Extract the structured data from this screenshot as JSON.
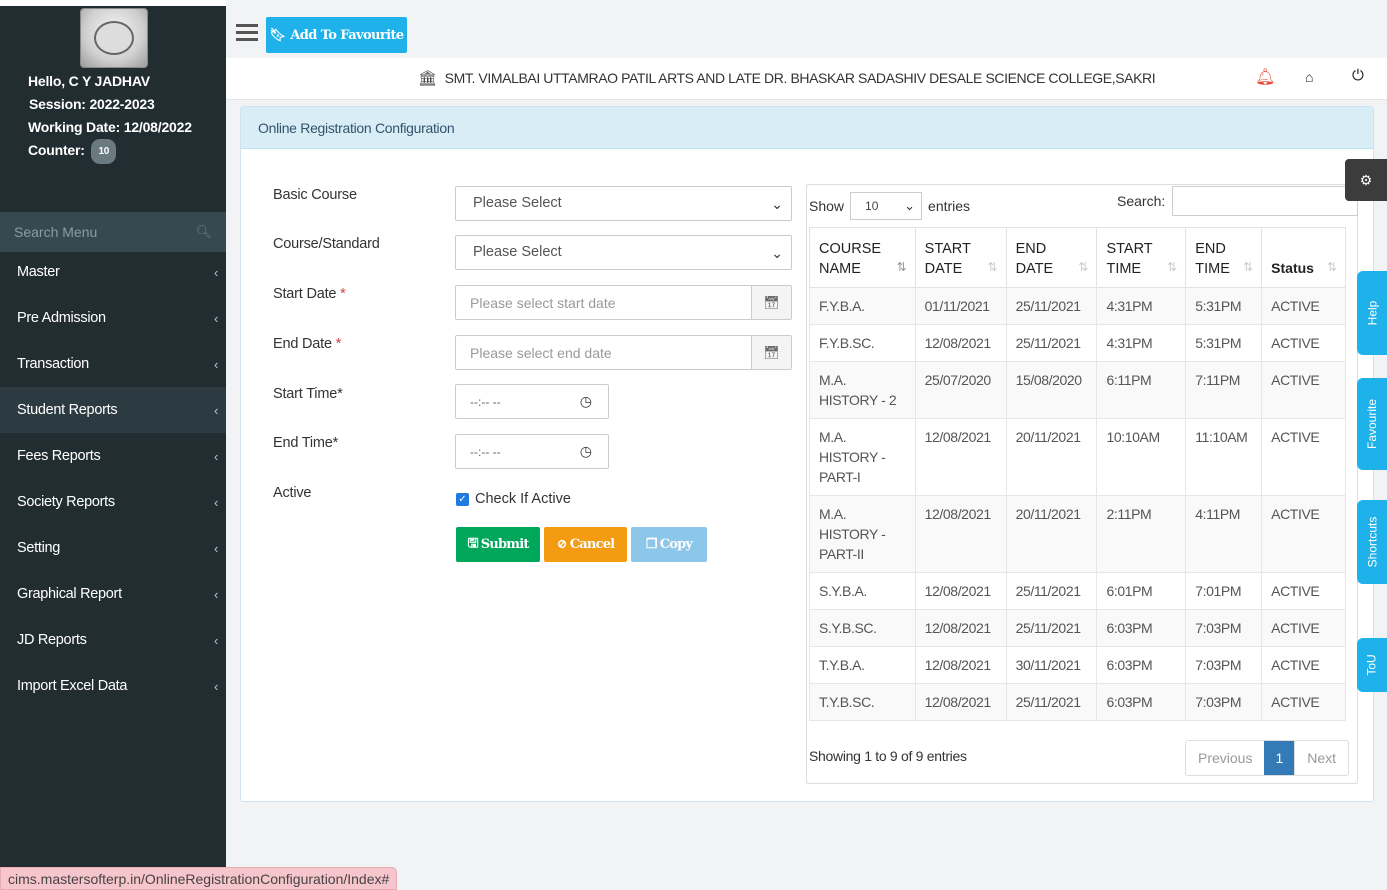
{
  "sidebar": {
    "user": {
      "greeting": "Hello, C Y JADHAV",
      "session": "Session: 2022-2023",
      "working_date": "Working Date: 12/08/2022",
      "counter_label": "Counter:",
      "counter_value": "10"
    },
    "search_placeholder": "Search Menu",
    "items": [
      {
        "label": "Master"
      },
      {
        "label": "Pre Admission"
      },
      {
        "label": "Transaction"
      },
      {
        "label": "Student Reports"
      },
      {
        "label": "Fees Reports"
      },
      {
        "label": "Society Reports"
      },
      {
        "label": "Setting"
      },
      {
        "label": "Graphical Report"
      },
      {
        "label": "JD Reports"
      },
      {
        "label": "Import Excel Data"
      }
    ],
    "active_item": "Student Reports"
  },
  "topbar": {
    "favourite_label": "Add To Favourite",
    "college_name": "SMT. VIMALBAI UTTAMRAO PATIL ARTS AND LATE DR. BHASKAR SADASHIV DESALE SCIENCE COLLEGE,SAKRI"
  },
  "panel": {
    "title": "Online Registration Configuration"
  },
  "form": {
    "basic_course_label": "Basic Course",
    "basic_course_value": "Please Select",
    "course_standard_label": "Course/Standard",
    "course_standard_value": "Please Select",
    "start_date_label": "Start Date",
    "start_date_placeholder": "Please select start date",
    "end_date_label": "End Date",
    "end_date_placeholder": "Please select end date",
    "start_time_label": "Start Time*",
    "start_time_value": "--:-- --",
    "end_time_label": "End Time*",
    "end_time_value": "--:-- --",
    "active_label": "Active",
    "active_checkbox_label": "Check If Active",
    "active_checked": true,
    "submit_label": "Submit",
    "cancel_label": "Cancel",
    "copy_label": "Copy"
  },
  "table": {
    "show_label": "Show",
    "length_value": "10",
    "entries_label": "entries",
    "search_label": "Search:",
    "headers": [
      {
        "line1": "COURSE",
        "line2": "NAME"
      },
      {
        "line1": "START",
        "line2": "DATE"
      },
      {
        "line1": "END",
        "line2": "DATE"
      },
      {
        "line1": "START",
        "line2": "TIME"
      },
      {
        "line1": "END",
        "line2": "TIME"
      },
      {
        "line1": "",
        "line2": "Status"
      }
    ],
    "rows": [
      {
        "course": "F.Y.B.A.",
        "start_date": "01/11/2021",
        "end_date": "25/11/2021",
        "start_time": "4:31PM",
        "end_time": "5:31PM",
        "status": "ACTIVE"
      },
      {
        "course": "F.Y.B.SC.",
        "start_date": "12/08/2021",
        "end_date": "25/11/2021",
        "start_time": "4:31PM",
        "end_time": "5:31PM",
        "status": "ACTIVE"
      },
      {
        "course": "M.A. HISTORY - 2",
        "start_date": "25/07/2020",
        "end_date": "15/08/2020",
        "start_time": "6:11PM",
        "end_time": "7:11PM",
        "status": "ACTIVE"
      },
      {
        "course": "M.A. HISTORY - PART-I",
        "start_date": "12/08/2021",
        "end_date": "20/11/2021",
        "start_time": "10:10AM",
        "end_time": "11:10AM",
        "status": "ACTIVE"
      },
      {
        "course": "M.A. HISTORY - PART-II",
        "start_date": "12/08/2021",
        "end_date": "20/11/2021",
        "start_time": "2:11PM",
        "end_time": "4:11PM",
        "status": "ACTIVE"
      },
      {
        "course": "S.Y.B.A.",
        "start_date": "12/08/2021",
        "end_date": "25/11/2021",
        "start_time": "6:01PM",
        "end_time": "7:01PM",
        "status": "ACTIVE"
      },
      {
        "course": "S.Y.B.SC.",
        "start_date": "12/08/2021",
        "end_date": "25/11/2021",
        "start_time": "6:03PM",
        "end_time": "7:03PM",
        "status": "ACTIVE"
      },
      {
        "course": "T.Y.B.A.",
        "start_date": "12/08/2021",
        "end_date": "30/11/2021",
        "start_time": "6:03PM",
        "end_time": "7:03PM",
        "status": "ACTIVE"
      },
      {
        "course": "T.Y.B.SC.",
        "start_date": "12/08/2021",
        "end_date": "25/11/2021",
        "start_time": "6:03PM",
        "end_time": "7:03PM",
        "status": "ACTIVE"
      }
    ],
    "info": "Showing 1 to 9 of 9 entries",
    "pager": {
      "previous": "Previous",
      "current": "1",
      "next": "Next"
    }
  },
  "side_tabs": [
    "Help",
    "Favourite",
    "Shortcuts",
    "ToU"
  ],
  "status_url": "cims.mastersofterp.in/OnlineRegistrationConfiguration/Index#",
  "colors": {
    "sidebar_bg": "#222d32",
    "accent": "#1fb2ea",
    "submit": "#00a65a",
    "cancel": "#f39c12",
    "copy": "#8cc6e8",
    "pager_active": "#337ab7"
  }
}
